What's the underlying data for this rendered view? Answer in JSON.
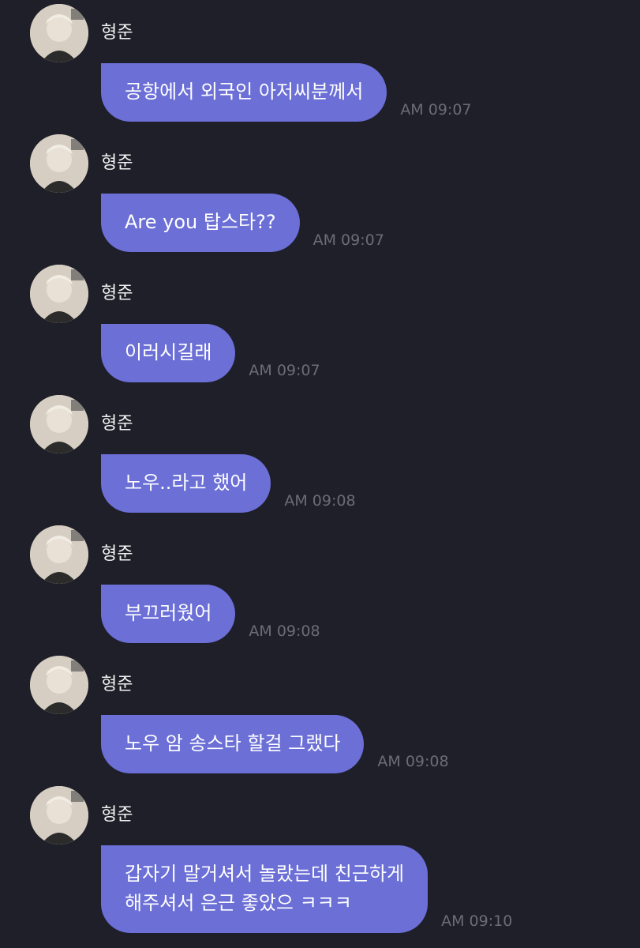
{
  "chat": {
    "messages": [
      {
        "sender": "형준",
        "text": "공항에서 외국인 아저씨분께서",
        "time": "AM 09:07"
      },
      {
        "sender": "형준",
        "text": "Are you 탑스타??",
        "time": "AM 09:07"
      },
      {
        "sender": "형준",
        "text": "이러시길래",
        "time": "AM 09:07"
      },
      {
        "sender": "형준",
        "text": "노우..라고 했어",
        "time": "AM 09:08"
      },
      {
        "sender": "형준",
        "text": "부끄러웠어",
        "time": "AM 09:08"
      },
      {
        "sender": "형준",
        "text": "노우 암 송스타 할걸 그랬다",
        "time": "AM 09:08"
      },
      {
        "sender": "형준",
        "text": "갑자기 말거셔서 놀랐는데 친근하게\n해주셔서 은근 좋았으 ㅋㅋㅋ",
        "time": "AM 09:10"
      }
    ]
  },
  "colors": {
    "background": "#1f1f29",
    "bubble": "#6b6fd6",
    "time_text": "#6c6c78",
    "sender_text": "#f2f2f2"
  },
  "icons": {
    "avatar": "avatar-icon"
  }
}
